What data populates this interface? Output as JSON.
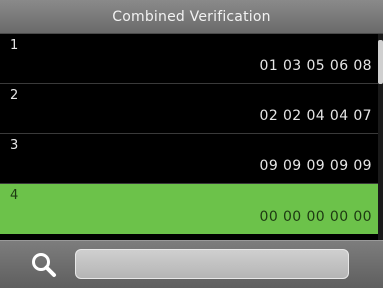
{
  "header": {
    "title": "Combined Verification"
  },
  "list": {
    "items": [
      {
        "index": "1",
        "code": "01 03 05 06 08",
        "selected": false
      },
      {
        "index": "2",
        "code": "02 02 04 04 07",
        "selected": false
      },
      {
        "index": "3",
        "code": "09 09 09 09 09",
        "selected": false
      },
      {
        "index": "4",
        "code": "00 00 00 00 00",
        "selected": true
      }
    ]
  },
  "search": {
    "value": "",
    "placeholder": "",
    "icon": "search-icon"
  },
  "colors": {
    "selected_row": "#6cc24a",
    "background": "#000000",
    "bars": "#707070"
  }
}
